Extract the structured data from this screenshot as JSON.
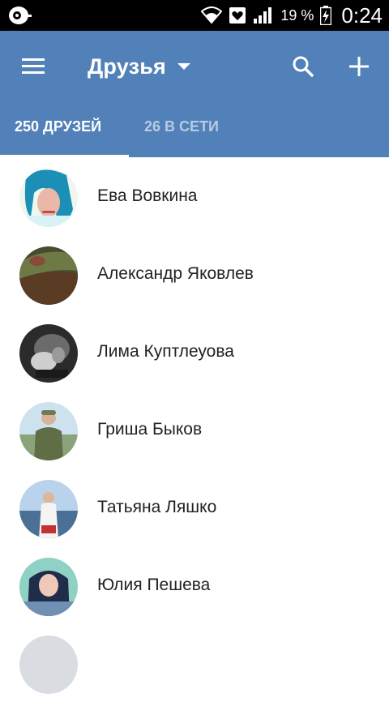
{
  "status_bar": {
    "battery": "19 %",
    "time": "0:24"
  },
  "header": {
    "title": "Друзья"
  },
  "tabs": [
    {
      "label": "250 ДРУЗЕЙ"
    },
    {
      "label": "26 В СЕТИ"
    }
  ],
  "friends": [
    {
      "name": "Ева Вовкина"
    },
    {
      "name": "Александр Яковлев"
    },
    {
      "name": "Лима Куптлеуова"
    },
    {
      "name": "Гриша Быков"
    },
    {
      "name": "Татьяна Ляшко"
    },
    {
      "name": "Юлия Пешева"
    }
  ],
  "colors": {
    "app_bar": "#5181b8",
    "status_bar": "#000000",
    "tab_active": "#ffffff",
    "tab_inactive": "#b7cbe3"
  },
  "icons": [
    "record-icon",
    "wifi-icon",
    "heart-notification-icon",
    "signal-icon",
    "battery-icon",
    "menu-icon",
    "caret-down-icon",
    "search-icon",
    "plus-icon"
  ]
}
